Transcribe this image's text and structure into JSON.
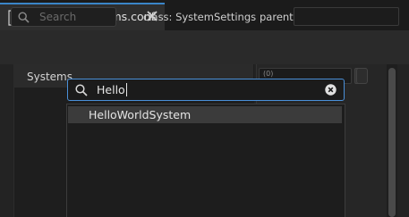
{
  "tab": {
    "title": "MyWorldSystems.conf",
    "icon": "config-file-icon"
  },
  "toolbar": {
    "search_placeholder": "Search",
    "class_label": "class: SystemSettings",
    "parent_label": "parent:",
    "parent_value": ""
  },
  "tree": {
    "systems_label": "Systems"
  },
  "inspector": {
    "field_value": "(0)"
  },
  "popup": {
    "search_value": "Hello",
    "results": [
      "HelloWorldSystem"
    ]
  },
  "colors": {
    "accent": "#3a86c8",
    "focus_border": "#4a90d9"
  }
}
